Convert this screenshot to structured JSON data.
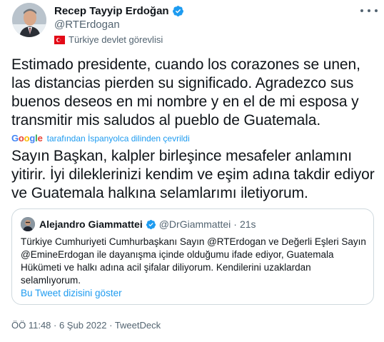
{
  "author": {
    "display_name": "Recep Tayyip Erdoğan",
    "handle": "@RTErdogan",
    "affiliation": "Türkiye devlet görevlisi",
    "verified_icon": "verified-badge-icon",
    "flag_icon": "turkey-flag-icon"
  },
  "tweet": {
    "translated_text": "Estimado presidente, cuando los corazones se unen, las distancias pierden su significado. Agradezco sus buenos deseos en mi nombre y en el de mi esposa y transmitir mis saludos al pueblo de Guatemala.",
    "translation_source": "Google",
    "translation_note": "tarafından İspanyolca dilinden çevrildi",
    "original_text": "Sayın Başkan, kalpler birleşince mesafeler anlamını yitirir. İyi dileklerinizi kendim ve eşim adına takdir ediyor ve Guatemala halkına selamlarımı iletiyorum."
  },
  "quoted_tweet": {
    "display_name": "Alejandro Giammattei",
    "handle": "@DrGiammattei",
    "separator": "·",
    "time": "21s",
    "text": "Türkiye Cumhuriyeti Cumhurbaşkanı Sayın @RTErdogan ve Değerli Eşleri Sayın @EmineErdogan ile dayanışma içinde olduğumu ifade ediyor, Guatemala Hükümeti ve halkı adına acil şifalar diliyorum. Kendilerini uzaklardan selamlıyorum.",
    "thread_link": "Bu Tweet dizisini göster"
  },
  "meta": {
    "time": "ÖÖ 11:48",
    "sep1": " · ",
    "date": "6 Şub 2022",
    "sep2": " · ",
    "source": "TweetDeck"
  },
  "colors": {
    "accent": "#1d9bf0",
    "secondary_text": "#536471",
    "border": "#cfd9de"
  }
}
